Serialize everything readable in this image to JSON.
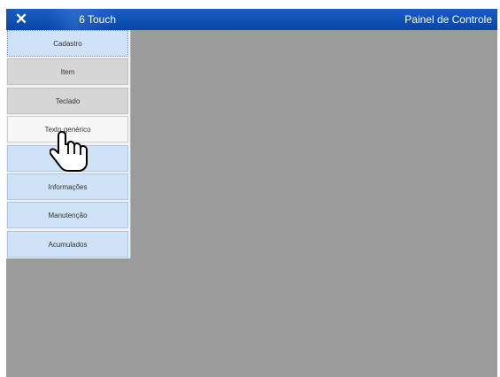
{
  "header": {
    "close_icon": "close-icon",
    "app_title": "6 Touch",
    "panel_title": "Painel de Controle"
  },
  "menu": {
    "items": [
      {
        "label": "Cadastro",
        "state": "blue"
      },
      {
        "label": "Item",
        "state": "gray"
      },
      {
        "label": "Teclado",
        "state": "gray"
      },
      {
        "label": "Texto genérico",
        "state": "white"
      },
      {
        "label": "",
        "state": "blue"
      },
      {
        "label": "Informações",
        "state": "blue"
      },
      {
        "label": "Manutenção",
        "state": "blue"
      },
      {
        "label": "Acumulados",
        "state": "blue"
      }
    ]
  },
  "cursor_icon": "hand-pointer-icon"
}
